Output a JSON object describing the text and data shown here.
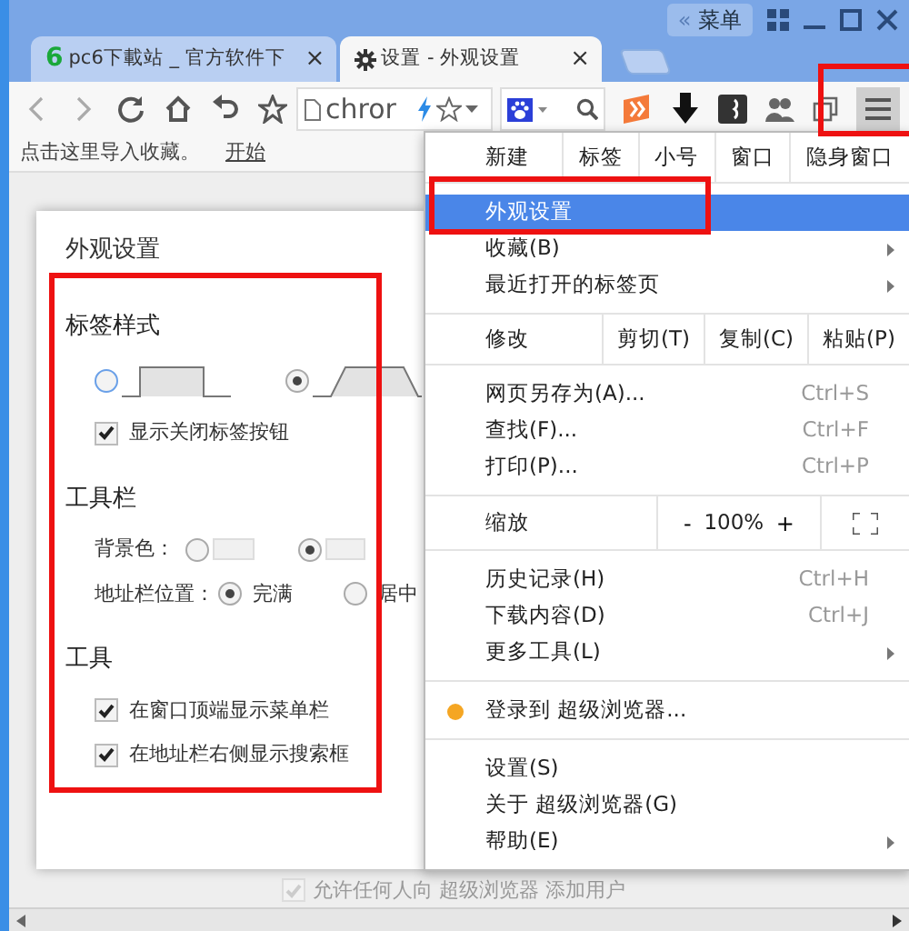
{
  "window": {
    "tabs": [
      {
        "icon_text": "6",
        "title": "pc6下載站 _ 官方软件下",
        "close": "×",
        "selected": false
      },
      {
        "title": "设置 - 外观设置",
        "close": "×",
        "selected": true
      }
    ],
    "caption_chevron": "«",
    "caption_menu": "菜单"
  },
  "toolbar": {
    "address": "chror"
  },
  "bookmarks_bar": {
    "hint": "点击这里导入收藏。",
    "link": "开始"
  },
  "dialog": {
    "title": "外观设置",
    "sections": [
      {
        "heading": "标签样式",
        "rows": [
          {
            "kind": "shape_radios",
            "options": [
              {
                "kind": "square",
                "selected": false
              },
              {
                "kind": "slanted",
                "selected": true
              }
            ]
          },
          {
            "kind": "checkbox",
            "label": "显示关闭标签按钮",
            "checked": true
          }
        ]
      },
      {
        "heading": "工具栏",
        "rows": [
          {
            "kind": "swatch_radios",
            "label": "背景色：",
            "options": [
              {
                "selected": false
              },
              {
                "selected": true
              }
            ]
          },
          {
            "kind": "text_radios",
            "label": "地址栏位置：",
            "options": [
              {
                "label": "完满",
                "selected": true
              },
              {
                "label": "居中",
                "selected": false
              }
            ]
          }
        ]
      },
      {
        "heading": "工具",
        "rows": [
          {
            "kind": "checkbox",
            "label": "在窗口顶端显示菜单栏",
            "checked": true
          },
          {
            "kind": "checkbox",
            "label": "在地址栏右侧显示搜索框",
            "checked": true
          }
        ]
      }
    ]
  },
  "menu": {
    "sections": [
      {
        "kind": "buttons",
        "cells": [
          "新建",
          "标签",
          "小号",
          "窗口",
          "隐身窗口"
        ]
      },
      {
        "kind": "group",
        "items": [
          {
            "label": "外观设置",
            "selected": true
          },
          {
            "label": "收藏(B)",
            "submenu": true,
            "selected": false
          },
          {
            "label": "最近打开的标签页",
            "submenu": true,
            "selected": false
          }
        ]
      },
      {
        "kind": "buttons",
        "label": "修改",
        "cells": [
          "剪切(T)",
          "复制(C)",
          "粘贴(P)"
        ]
      },
      {
        "kind": "group",
        "items": [
          {
            "label": "网页另存为(A)...",
            "shortcut": "Ctrl+S",
            "selected": false
          },
          {
            "label": "查找(F)...",
            "shortcut": "Ctrl+F",
            "selected": false
          },
          {
            "label": "打印(P)...",
            "shortcut": "Ctrl+P",
            "selected": false
          }
        ]
      },
      {
        "kind": "zoom",
        "label": "缩放",
        "minus": "-",
        "value": "100%",
        "plus": "+"
      },
      {
        "kind": "group",
        "items": [
          {
            "label": "历史记录(H)",
            "shortcut": "Ctrl+H",
            "selected": false
          },
          {
            "label": "下载内容(D)",
            "shortcut": "Ctrl+J",
            "selected": false
          },
          {
            "label": "更多工具(L)",
            "submenu": true,
            "selected": false
          }
        ]
      },
      {
        "kind": "group",
        "items": [
          {
            "label": "登录到 超级浏览器...",
            "color": "#f5a623",
            "selected": false
          }
        ]
      },
      {
        "kind": "group",
        "items": [
          {
            "label": "设置(S)",
            "selected": false
          },
          {
            "label": "关于 超级浏览器(G)",
            "selected": false
          },
          {
            "label": "帮助(E)",
            "submenu": true,
            "selected": false
          }
        ]
      }
    ]
  },
  "page_behind": {
    "label": "允许任何人向 超级浏览器 添加用户",
    "checked": true
  }
}
